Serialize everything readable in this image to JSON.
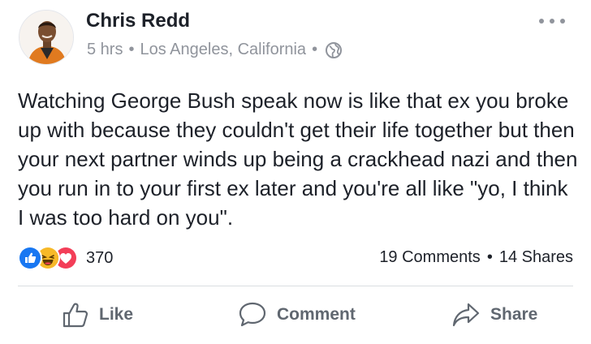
{
  "post": {
    "author": "Chris Redd",
    "time": "5 hrs",
    "location": "Los Angeles, California",
    "privacy_icon": "globe-icon",
    "text": "Watching George Bush speak now is like that ex you broke up with because they couldn't get their life together but then your next partner winds up being a crackhead nazi and then you run in to your first ex later and you're all like \"yo, I think I was too hard on you\"."
  },
  "reactions": {
    "icons": [
      "like-reaction-icon",
      "haha-reaction-icon",
      "love-reaction-icon"
    ],
    "count": "370"
  },
  "engagement": {
    "comments": "19 Comments",
    "shares": "14 Shares"
  },
  "actions": {
    "like": "Like",
    "comment": "Comment",
    "share": "Share"
  },
  "colors": {
    "like_blue": "#1877f2",
    "haha_yellow": "#f7b928",
    "love_red": "#f33e58",
    "secondary_text": "#90949c",
    "action_text": "#606770"
  }
}
